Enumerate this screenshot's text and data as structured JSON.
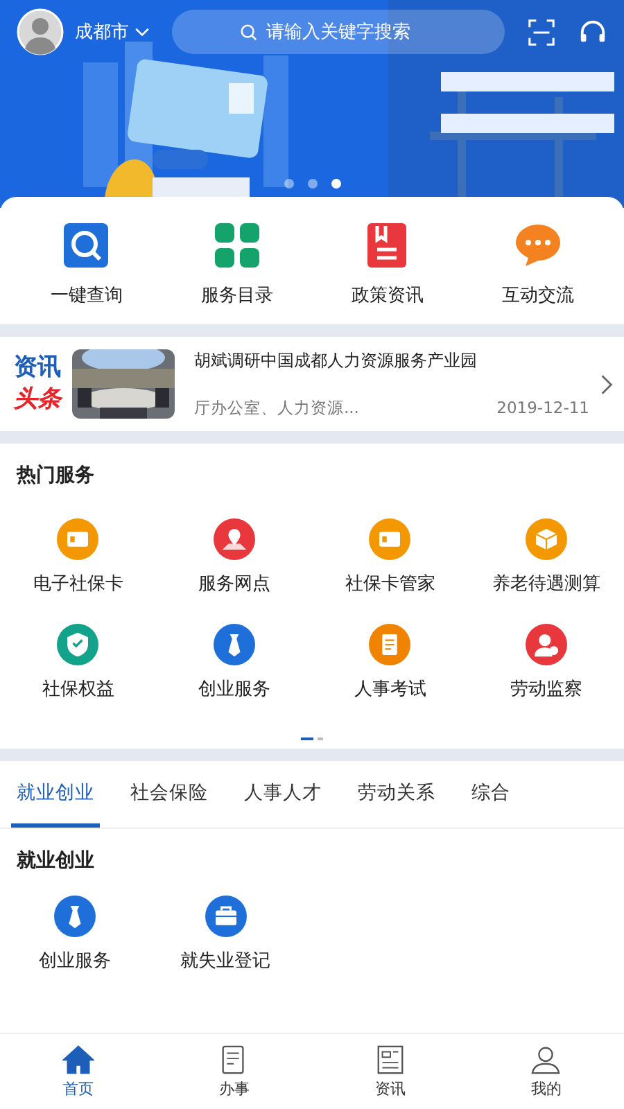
{
  "header": {
    "city": "成都市",
    "search": {
      "placeholder": "请输入关键字搜索"
    },
    "dots": [
      {
        "selected": false
      },
      {
        "selected": false
      },
      {
        "selected": true
      }
    ]
  },
  "quick": [
    {
      "label": "一键查询",
      "kind": "search",
      "color": "#1e6fd9"
    },
    {
      "label": "服务目录",
      "kind": "grid",
      "color": "#13a36b"
    },
    {
      "label": "政策资讯",
      "kind": "doc",
      "color": "#e8383d"
    },
    {
      "label": "互动交流",
      "kind": "chat",
      "color": "#f58220"
    }
  ],
  "news": {
    "logo_top": "资讯",
    "logo_bottom": "头条",
    "title": "胡斌调研中国成都人力资源服务产业园",
    "source": "厅办公室、人力资源...",
    "date": "2019-12-11"
  },
  "hot": {
    "title": "热门服务",
    "items": [
      {
        "label": "电子社保卡",
        "kind": "card",
        "color": "#f39800"
      },
      {
        "label": "服务网点",
        "kind": "pin",
        "color": "#e8383d"
      },
      {
        "label": "社保卡管家",
        "kind": "card",
        "color": "#f39800"
      },
      {
        "label": "养老待遇测算",
        "kind": "box",
        "color": "#f39800"
      },
      {
        "label": "社保权益",
        "kind": "shield",
        "color": "#13a38b"
      },
      {
        "label": "创业服务",
        "kind": "tie",
        "color": "#1e6fd9"
      },
      {
        "label": "人事考试",
        "kind": "doc",
        "color": "#f08300"
      },
      {
        "label": "劳动监察",
        "kind": "person",
        "color": "#e8383d"
      }
    ],
    "pages": [
      {
        "selected": true
      },
      {
        "selected": false
      }
    ]
  },
  "tabs": [
    {
      "label": "就业创业",
      "selected": true
    },
    {
      "label": "社会保险",
      "selected": false
    },
    {
      "label": "人事人才",
      "selected": false
    },
    {
      "label": "劳动关系",
      "selected": false
    },
    {
      "label": "综合",
      "selected": false
    }
  ],
  "section": {
    "title": "就业创业",
    "items": [
      {
        "label": "创业服务",
        "kind": "tie",
        "color": "#1e6fd9"
      },
      {
        "label": "就失业登记",
        "kind": "case",
        "color": "#1e6fd9"
      }
    ]
  },
  "nav": [
    {
      "label": "首页",
      "kind": "home",
      "selected": true
    },
    {
      "label": "办事",
      "kind": "note",
      "selected": false
    },
    {
      "label": "资讯",
      "kind": "paper",
      "selected": false
    },
    {
      "label": "我的",
      "kind": "user",
      "selected": false
    }
  ]
}
